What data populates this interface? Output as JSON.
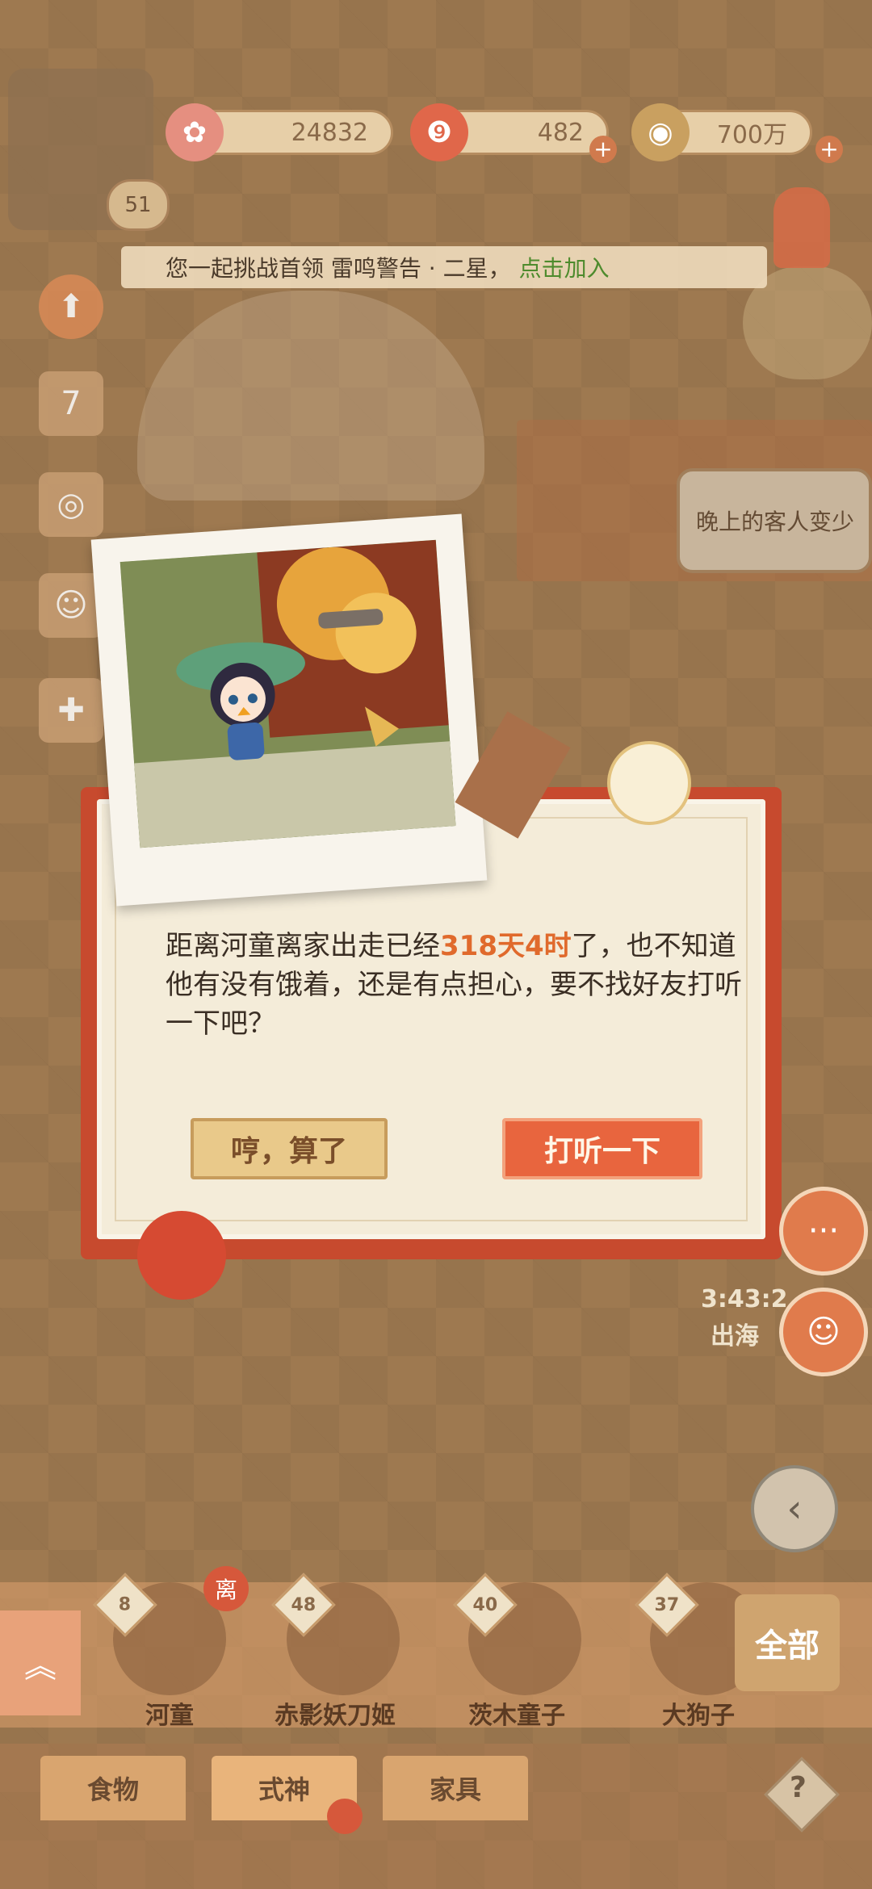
{
  "currencies": [
    {
      "name": "sakura-currency",
      "value": "24832"
    },
    {
      "name": "gem-currency",
      "value": "482"
    },
    {
      "name": "coin-currency",
      "value": "700万"
    }
  ],
  "player": {
    "level": "51"
  },
  "banner": {
    "text": "您一起挑战首领 雷鸣警告 · 二星，",
    "link": "点击加入"
  },
  "speech_bubble": {
    "text": "晚上的客人变少"
  },
  "dialog": {
    "msg_part1": "距离河童离家出走已经",
    "msg_highlight": "318天4时",
    "msg_part2": "了，也不知道他有没有饿着，还是有点担心，要不找好友打听一下吧？",
    "decline_label": "哼，算了",
    "accept_label": "打听一下"
  },
  "timer": {
    "text": "3:43:2",
    "label": "出海"
  },
  "roster": {
    "all_label": "全部",
    "characters": [
      {
        "name": "河童",
        "level": "8",
        "badge": "离"
      },
      {
        "name": "赤影妖刀姬",
        "level": "48"
      },
      {
        "name": "茨木童子",
        "level": "40"
      },
      {
        "name": "大狗子",
        "level": "37"
      }
    ]
  },
  "tabs": [
    "食物",
    "式神",
    "家具"
  ],
  "left_icons": [
    "up-arrow-icon",
    "calendar-icon",
    "gacha-icon",
    "character-icon",
    "gift-icon"
  ],
  "colors": {
    "accent_red": "#c74a2e",
    "highlight": "#e06a2c",
    "link_green": "#4e8b2d"
  }
}
